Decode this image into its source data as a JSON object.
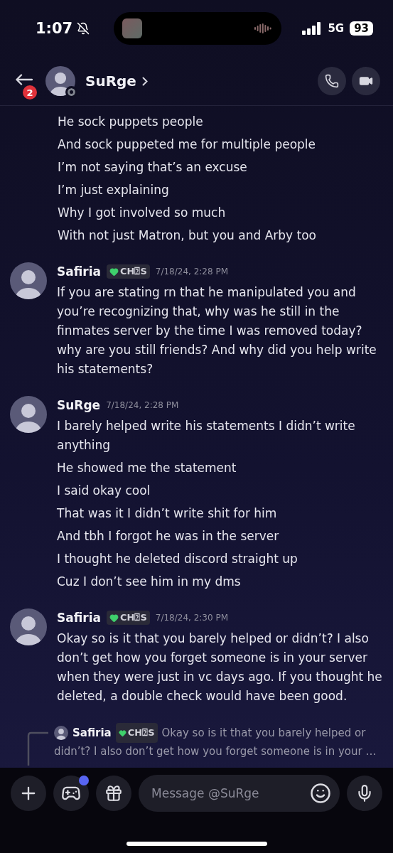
{
  "status_bar": {
    "time": "1:07",
    "network": "5G",
    "battery": "93",
    "silenced": true
  },
  "header": {
    "back_badge": "2",
    "name": "SuRge",
    "online": false
  },
  "messages": [
    {
      "lines": [
        "He sock puppets people",
        "And sock puppeted me for multiple people",
        "I’m not saying that’s an excuse",
        "I’m just explaining",
        "Why I got involved so much",
        "With not just Matron, but you and Arby too"
      ]
    },
    {
      "author": "Safiria",
      "badge": "CH⍰S",
      "timestamp": "7/18/24, 2:28 PM",
      "lines": [
        "If you are stating rn that he manipulated you and you’re recognizing that, why was he still in the finmates server by the time I was removed today? why are you still friends? And why did you help write his statements?"
      ]
    },
    {
      "author": "SuRge",
      "timestamp": "7/18/24, 2:28 PM",
      "lines": [
        "I barely helped write his statements I didn’t write anything",
        "He showed me the statement",
        "I said okay cool",
        "That was it I didn’t write shit for him",
        "And tbh I forgot he was in the server",
        "I thought he deleted discord straight up",
        "Cuz I don’t see him in my dms"
      ]
    },
    {
      "author": "Safiria",
      "badge": "CH⍰S",
      "timestamp": "7/18/24, 2:30 PM",
      "lines": [
        "Okay so is it that you barely helped or didn’t? I also don’t get how you forget someone is in your server when they were just in vc days ago. If you thought he deleted, a double check would have been good."
      ]
    }
  ],
  "reply_preview": {
    "author": "Safiria",
    "badge": "CH⍰S",
    "text_lines": [
      "Okay so is it that you barely helped or",
      "didn’t? I also don’t get how you forget someone is in your …"
    ]
  },
  "composer": {
    "placeholder": "Message @SuRge",
    "games_unread": true
  }
}
